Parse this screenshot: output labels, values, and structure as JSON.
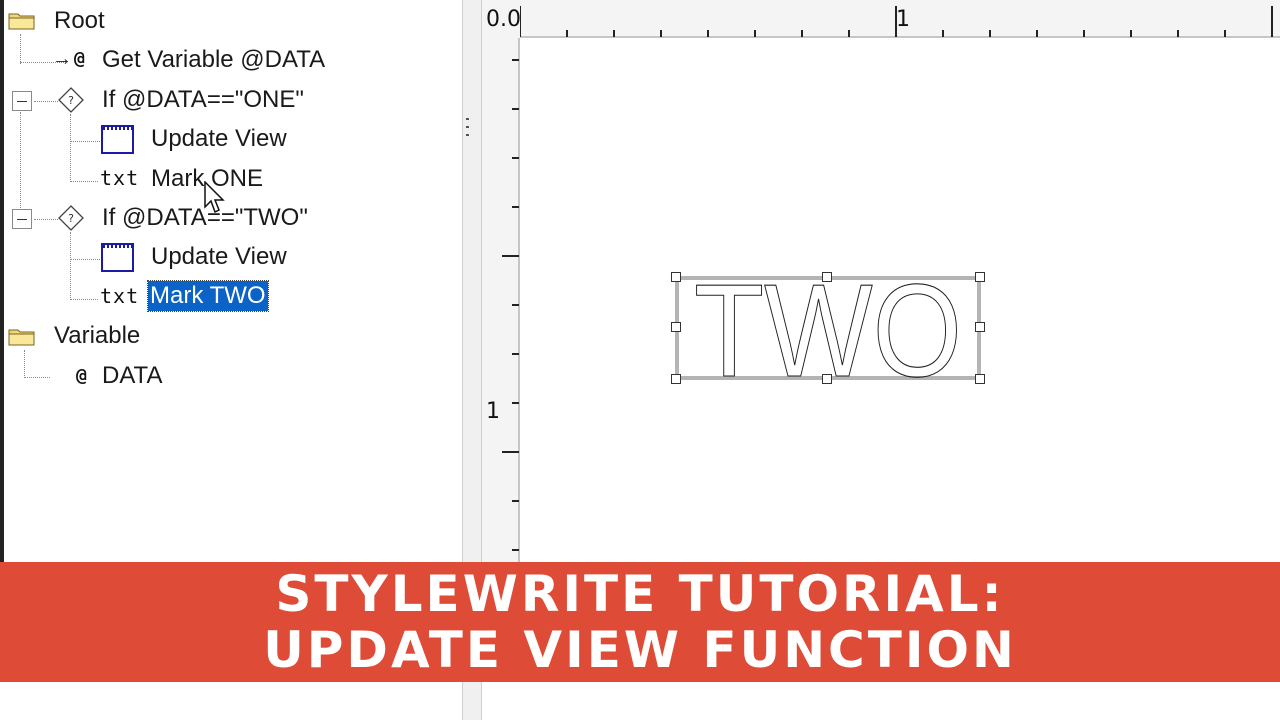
{
  "tree": {
    "root_label": "Root",
    "get_variable_label": "Get Variable @DATA",
    "if_one_label": "If @DATA==\"ONE\"",
    "update_view_1_label": "Update View",
    "mark_one_label": "Mark ONE",
    "if_two_label": "If @DATA==\"TWO\"",
    "update_view_2_label": "Update View",
    "mark_two_label": "Mark TWO",
    "variable_label": "Variable",
    "data_label": "DATA",
    "txt_icon_text": "txt"
  },
  "ruler": {
    "top_origin": "0.0",
    "top_one": "1",
    "left_one": "1"
  },
  "canvas": {
    "mark_text": "TWO"
  },
  "banner": {
    "line1": "STYLEWRITE TUTORIAL:",
    "line2": "UPDATE VIEW FUNCTION",
    "color": "#de4b37"
  },
  "selection_color": "#0b63c8"
}
